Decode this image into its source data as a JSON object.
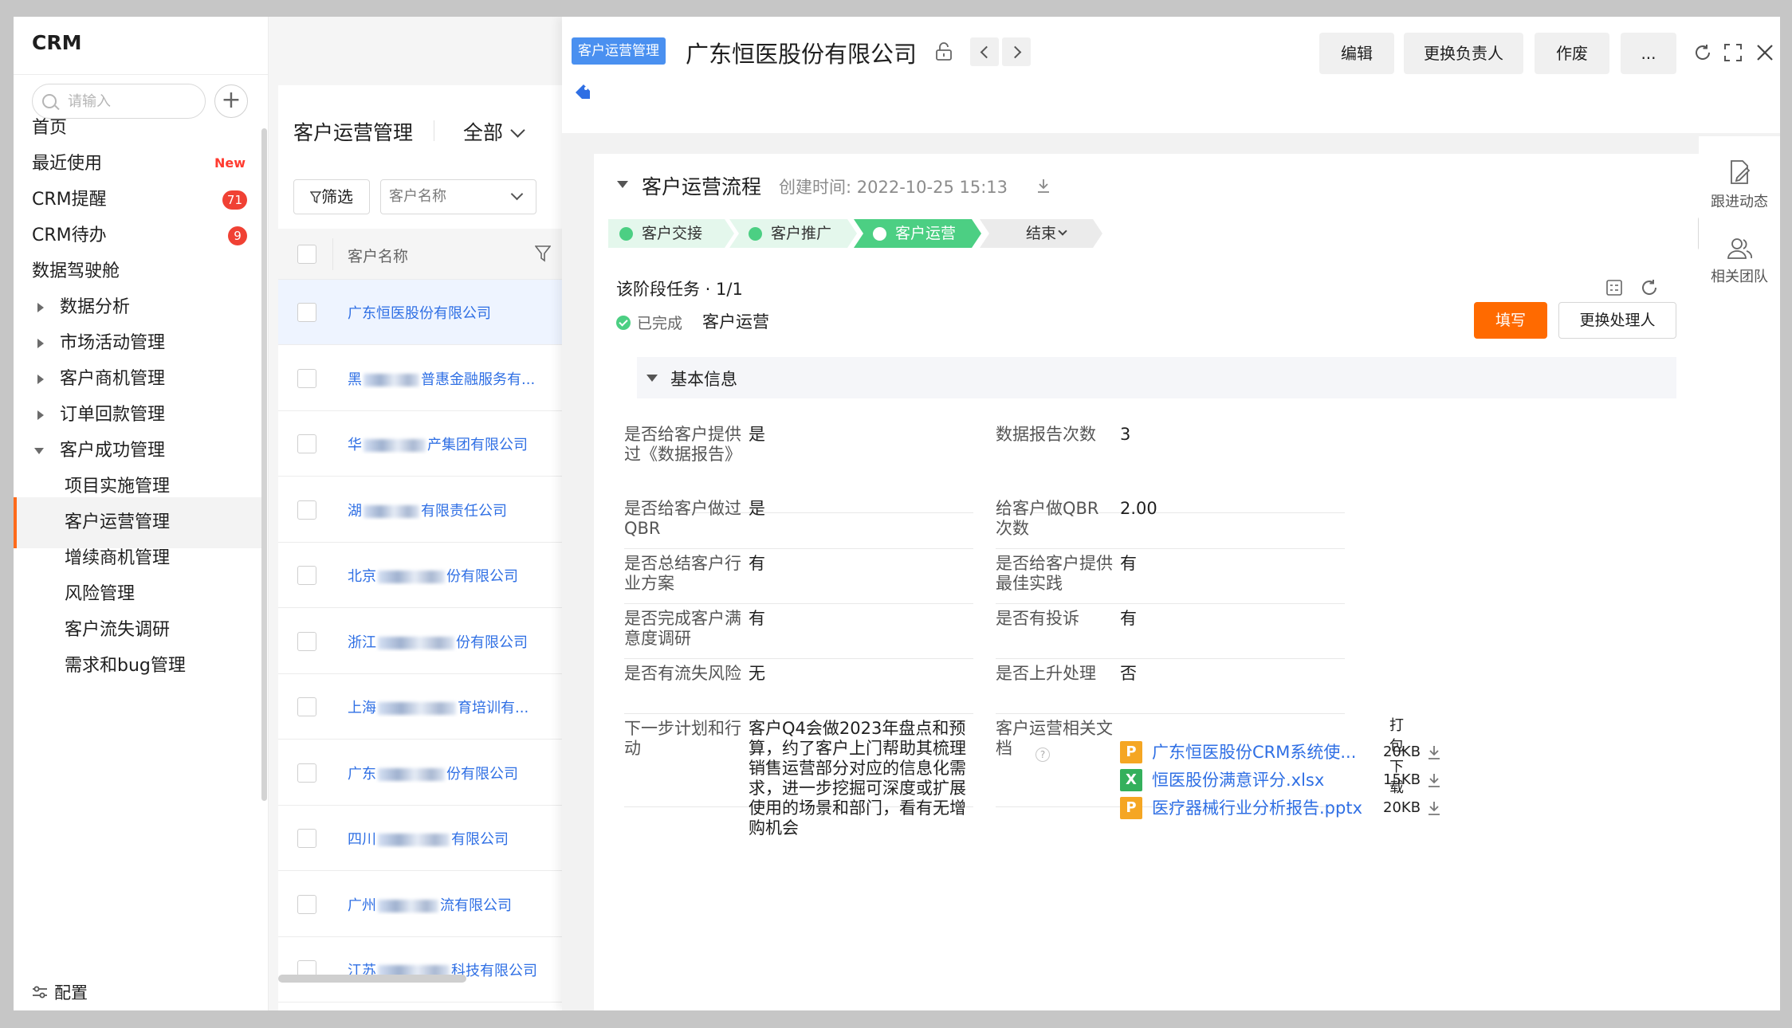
{
  "nav": {
    "brand": "CRM",
    "search_placeholder": "请输入",
    "add_label": "+",
    "items": [
      {
        "label": "首页"
      },
      {
        "label": "最近使用",
        "badge": "New"
      },
      {
        "label": "CRM提醒",
        "count": "71"
      },
      {
        "label": "CRM待办",
        "count": "9"
      },
      {
        "label": "数据驾驶舱"
      }
    ],
    "groups": [
      {
        "label": "数据分析"
      },
      {
        "label": "市场活动管理"
      },
      {
        "label": "客户商机管理"
      },
      {
        "label": "订单回款管理"
      },
      {
        "label": "客户成功管理"
      }
    ],
    "subitems": [
      {
        "label": "项目实施管理"
      },
      {
        "label": "客户运营管理"
      },
      {
        "label": "增续商机管理"
      },
      {
        "label": "风险管理"
      },
      {
        "label": "客户流失调研"
      },
      {
        "label": "需求和bug管理"
      }
    ],
    "config": "配置"
  },
  "list": {
    "title": "客户运营管理",
    "scope": "全部",
    "filter_label": "筛选",
    "select_placeholder": "客户名称",
    "column": "客户名称",
    "rows": [
      {
        "pre": "广东恒医股份有限公司",
        "post": ""
      },
      {
        "pre": "黑",
        "post": "普惠金融服务有..."
      },
      {
        "pre": "华",
        "post": "产集团有限公司"
      },
      {
        "pre": "湖",
        "post": "有限责任公司"
      },
      {
        "pre": "北京",
        "post": "份有限公司"
      },
      {
        "pre": "浙江",
        "post": "份有限公司"
      },
      {
        "pre": "上海",
        "post": "育培训有..."
      },
      {
        "pre": "广东",
        "post": "份有限公司"
      },
      {
        "pre": "四川",
        "post": "有限公司"
      },
      {
        "pre": "广州",
        "post": "流有限公司"
      },
      {
        "pre": "江苏",
        "post": "科技有限公司"
      }
    ]
  },
  "detail": {
    "tag": "客户运营管理",
    "title": "广东恒医股份有限公司",
    "buttons": {
      "edit": "编辑",
      "change_owner": "更换负责人",
      "void": "作废",
      "more": "..."
    },
    "process": {
      "title": "客户运营流程",
      "created_label": "创建时间:",
      "created_at": "2022-10-25 15:13",
      "stages": [
        {
          "label": "客户交接"
        },
        {
          "label": "客户推广"
        },
        {
          "label": "客户运营"
        },
        {
          "label": "结束"
        }
      ]
    },
    "task": {
      "title": "该阶段任务 · 1/1",
      "status": "已完成",
      "name": "客户运营",
      "fill_btn": "填写",
      "handler_btn": "更换处理人"
    },
    "basic": {
      "title": "基本信息",
      "fields": [
        {
          "k": "是否给客户提供过《数据报告》",
          "v": "是"
        },
        {
          "k": "数据报告次数",
          "v": "3"
        },
        {
          "k": "是否给客户做过QBR",
          "v": "是"
        },
        {
          "k": "给客户做QBR次数",
          "v": "2.00"
        },
        {
          "k": "是否总结客户行业方案",
          "v": "有"
        },
        {
          "k": "是否给客户提供最佳实践",
          "v": "有"
        },
        {
          "k": "是否完成客户满意度调研",
          "v": "有"
        },
        {
          "k": "是否有投诉",
          "v": "有"
        },
        {
          "k": "是否有流失风险",
          "v": "无"
        },
        {
          "k": "是否上升处理",
          "v": "否"
        },
        {
          "k": "下一步计划和行动",
          "v": "客户Q4会做2023年盘点和预算，约了客户上门帮助其梳理销售运营部分对应的信息化需求，进一步挖掘可深度或扩展使用的场景和部门，看有无增购机会"
        },
        {
          "k": "客户运营相关文档",
          "v": ""
        }
      ],
      "docs_help": "?",
      "pack_download": "打包下载",
      "docs": [
        {
          "type": "P",
          "color": "#f5a623",
          "name": "广东恒医股份CRM系统使...",
          "size": "20KB"
        },
        {
          "type": "X",
          "color": "#34b05c",
          "name": "恒医股份满意评分.xlsx",
          "size": "15KB"
        },
        {
          "type": "P",
          "color": "#f5a623",
          "name": "医疗器械行业分析报告.pptx",
          "size": "20KB"
        }
      ]
    },
    "side": {
      "follow": "跟进动态",
      "team": "相关团队"
    }
  }
}
